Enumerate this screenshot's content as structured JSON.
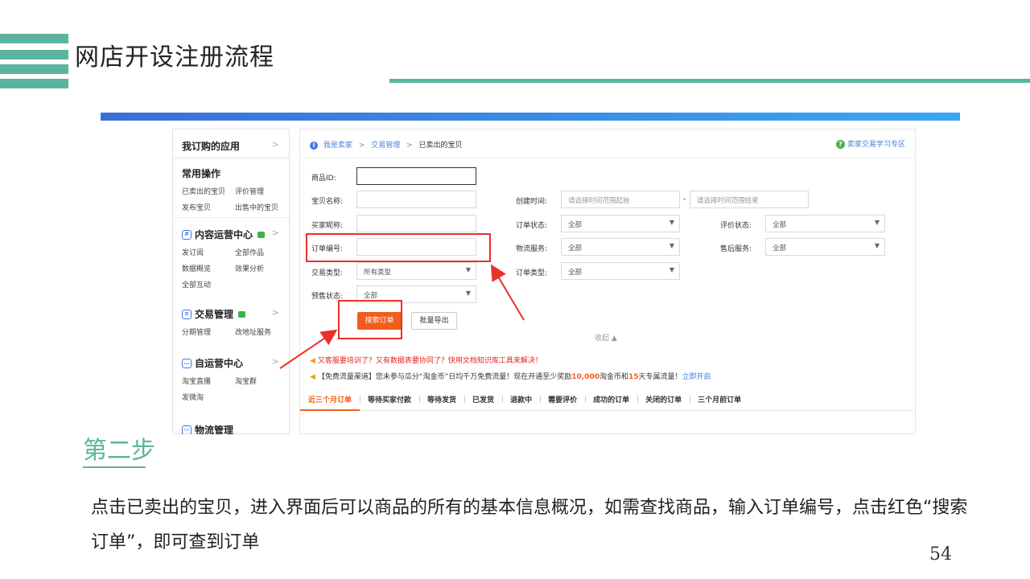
{
  "slide": {
    "title": "网店开设注册流程",
    "step": "第二步",
    "description": "点击已卖出的宝贝，进入界面后可以商品的所有的基本信息概况，如需查找商品，输入订单编号，点击红色“搜索订单”，即可查到订单",
    "page_number": "54"
  },
  "sidebar": {
    "header": "我订购的应用",
    "sections": [
      {
        "title": "常用操作",
        "items": [
          "已卖出的宝贝",
          "评价管理",
          "发布宝贝",
          "出售中的宝贝"
        ]
      },
      {
        "title": "内容运营中心",
        "items": [
          "发订阅",
          "全部作品",
          "数据概览",
          "效果分析",
          "全部互动"
        ]
      },
      {
        "title": "交易管理",
        "items": [
          "分期管理",
          "改地址服务"
        ]
      },
      {
        "title": "自运营中心",
        "items": [
          "淘宝直播",
          "淘宝群",
          "发微淘"
        ]
      },
      {
        "title": "物流管理",
        "items": []
      }
    ]
  },
  "breadcrumb": {
    "items": [
      "我是卖家",
      "交易管理",
      "已卖出的宝贝"
    ],
    "help_link": "卖家交易学习专区"
  },
  "form": {
    "product_id_label": "商品ID:",
    "item_name_label": "宝贝名称:",
    "create_time_label": "创建时间:",
    "time_start_placeholder": "请选择时间范围起始",
    "time_end_placeholder": "请选择时间范围结束",
    "buyer_nick_label": "买家昵称:",
    "order_status_label": "订单状态:",
    "order_status_value": "全部",
    "review_status_label": "评价状态:",
    "review_status_value": "全部",
    "order_no_label": "订单编号:",
    "logistics_label": "物流服务:",
    "logistics_value": "全部",
    "after_sale_label": "售后服务:",
    "after_sale_value": "全部",
    "trade_type_label": "交易类型:",
    "trade_type_value": "所有类型",
    "order_type_label": "订单类型:",
    "order_type_value": "全部",
    "presale_label": "预售状态:",
    "presale_value": "全部",
    "time_dash": "-",
    "search_button": "搜索订单",
    "export_button": "批量导出",
    "collapse": "收起 ▲"
  },
  "notices": {
    "line1": "又客服要培训了？又有数据表要协同了？快用文档知识库工具来解决！",
    "line2_a": "【免费流量渠道】您未参与瓜分“淘金币”日均千万免费流量！现在开通至少奖励",
    "line2_num1": "10,000",
    "line2_b": "淘金币和",
    "line2_num2": "15",
    "line2_c": "天专属流量！",
    "line2_link": "立即开启"
  },
  "tabs": [
    "近三个月订单",
    "等待买家付款",
    "等待发货",
    "已发货",
    "退款中",
    "需要评价",
    "成功的订单",
    "关闭的订单",
    "三个月前订单"
  ],
  "colors": {
    "accent_teal": "#5bb4a0",
    "highlight_red": "#e8312b",
    "search_orange": "#f25c1c"
  }
}
